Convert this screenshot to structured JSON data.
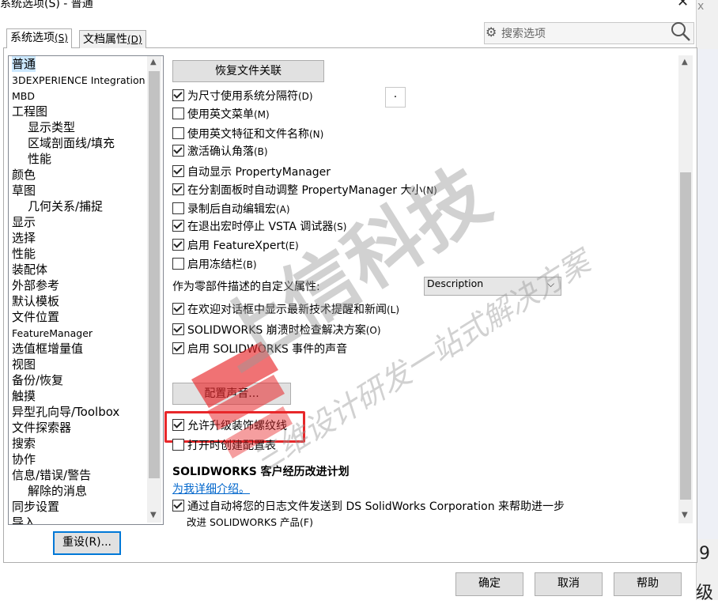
{
  "window": {
    "title": "系统选项(S) - 普通",
    "close": "✕"
  },
  "tabs": [
    {
      "label": "系统选项",
      "key": "(S)"
    },
    {
      "label": "文档属性",
      "key": "(D)"
    }
  ],
  "search": {
    "placeholder": "搜索选项"
  },
  "tree": [
    "普通",
    "3DEXPERIENCE Integration",
    "MBD",
    "工程图",
    "显示类型",
    "区域剖面线/填充",
    "性能",
    "颜色",
    "草图",
    "几何关系/捕捉",
    "显示",
    "选择",
    "性能",
    "装配体",
    "外部参考",
    "默认模板",
    "文件位置",
    "FeatureManager",
    "选值框增量值",
    "视图",
    "备份/恢复",
    "触摸",
    "异型孔向导/Toolbox",
    "文件探索器",
    "搜索",
    "协作",
    "信息/错误/警告",
    "解除的消息",
    "同步设置",
    "导入"
  ],
  "buttons": {
    "reset": "重设(R)...",
    "restore_assoc": "恢复文件关联",
    "config_sound": "配置声音...",
    "ok": "确定",
    "cancel": "取消",
    "help": "帮助"
  },
  "options": [
    {
      "label": "为尺寸使用系统分隔符",
      "key": "(D)",
      "checked": true
    },
    {
      "label": "使用英文菜单",
      "key": "(M)",
      "checked": false
    },
    {
      "label": "使用英文特征和文件名称",
      "key": "(N)",
      "checked": false
    },
    {
      "label": "激活确认角落",
      "key": "(B)",
      "checked": true
    },
    {
      "label": "自动显示 PropertyManager",
      "key": "",
      "checked": true
    },
    {
      "label": "在分割面板时自动调整 PropertyManager 大小",
      "key": "(N)",
      "checked": true
    },
    {
      "label": "录制后自动编辑宏",
      "key": "(A)",
      "checked": false
    },
    {
      "label": "在退出宏时停止 VSTA 调试器",
      "key": "(S)",
      "checked": true
    },
    {
      "label": "启用 FeatureXpert",
      "key": "(E)",
      "checked": true
    },
    {
      "label": "启用冻结栏",
      "key": "(B)",
      "checked": false
    },
    {
      "label": "在欢迎对话框中显示最新技术提醒和新闻",
      "key": "(L)",
      "checked": true
    },
    {
      "label": "SOLIDWORKS 崩溃时检查解决方案",
      "key": "(O)",
      "checked": true
    },
    {
      "label": "启用 SOLIDWORKS 事件的声音",
      "key": "",
      "checked": true
    },
    {
      "label": "允许升级装饰螺纹线",
      "key": "",
      "checked": true
    },
    {
      "label": "打开时创建配置表",
      "key": "",
      "checked": false
    },
    {
      "label": "通过自动将您的日志文件发送到 DS SolidWorks Corporation 来帮助进一步",
      "key": "",
      "checked": true
    }
  ],
  "separator_value": ".",
  "custom_prop": {
    "label": "作为零部件描述的自定义属性:",
    "value": "Description"
  },
  "ceip": {
    "title": "SOLIDWORKS 客户经历改进计划",
    "link": "为我详细介绍。",
    "line2": "改进 SOLIDWORKS 产品(F)"
  },
  "side": {
    "x": "x",
    "num": "9",
    "level": "级"
  },
  "watermark": {
    "big": "上信科技",
    "small": "三维设计研发一站式解决方案"
  },
  "colors": {
    "highlight": "#e8272a",
    "link": "#0066cc",
    "selection": "#cce8ff"
  }
}
